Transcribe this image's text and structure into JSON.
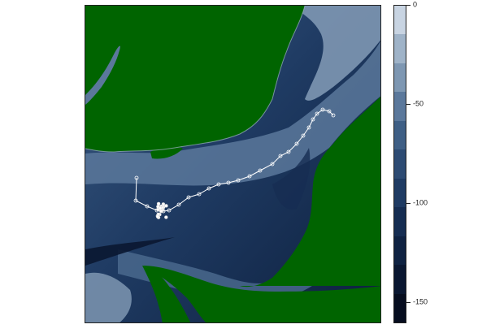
{
  "map": {
    "land_color": "#006400",
    "depth_palette": [
      "#c8d4e2",
      "#9fb3c8",
      "#7e97b2",
      "#5b789b",
      "#3f5f85",
      "#2d4b73",
      "#1f3b63",
      "#162d52",
      "#0f2242",
      "#0a1731",
      "#060d1f"
    ],
    "track_color": "#ffffff",
    "track_point_count": 28,
    "cluster_point_count": 22
  },
  "legend": {
    "title": "",
    "range": [
      -160,
      0
    ],
    "ticks": [
      {
        "value": 0,
        "label": "0"
      },
      {
        "value": -50,
        "label": "-50"
      },
      {
        "value": -100,
        "label": "-100"
      },
      {
        "value": -150,
        "label": "-150"
      }
    ],
    "colors": [
      "#c8d4e2",
      "#9fb3c8",
      "#7e97b2",
      "#5b789b",
      "#3f5f85",
      "#2d4b73",
      "#1f3b63",
      "#162d52",
      "#0f2242",
      "#0a1731",
      "#060d1f"
    ]
  }
}
